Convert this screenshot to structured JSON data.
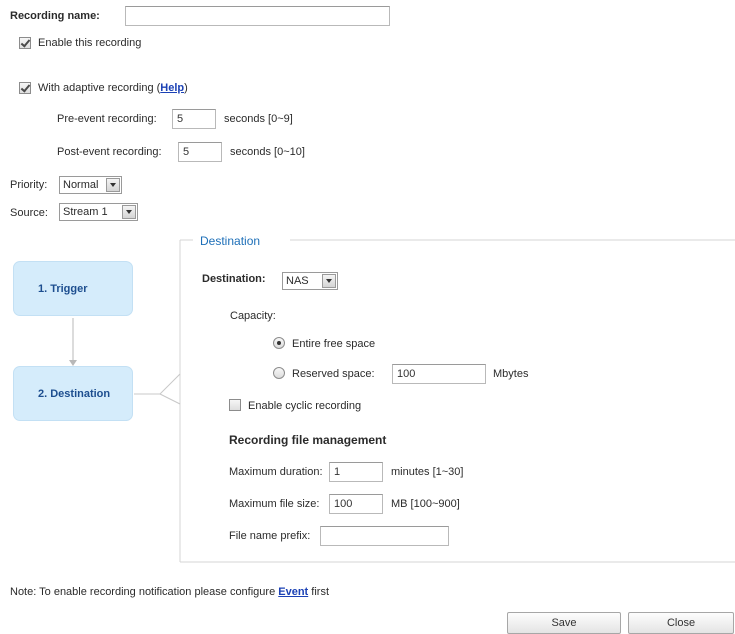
{
  "recording_name": {
    "label": "Recording name:",
    "value": ""
  },
  "enable_recording": {
    "label": "Enable this recording",
    "checked": true
  },
  "adaptive": {
    "label": "With adaptive recording (",
    "help_link": "Help",
    "label_close": ")",
    "checked": true,
    "pre_event": {
      "label": "Pre-event recording:",
      "value": "5",
      "unit": "seconds [0~9]"
    },
    "post_event": {
      "label": "Post-event recording:",
      "value": "5",
      "unit": "seconds [0~10]"
    }
  },
  "priority": {
    "label": "Priority:",
    "value": "Normal"
  },
  "source": {
    "label": "Source:",
    "value": "Stream 1"
  },
  "steps": {
    "trigger": "1. Trigger",
    "destination": "2. Destination"
  },
  "destination": {
    "section_title": "Destination",
    "label": "Destination:",
    "value": "NAS",
    "capacity": {
      "label": "Capacity:",
      "entire_free_space": "Entire free space",
      "reserved_space": "Reserved space:",
      "reserved_value": "100",
      "reserved_unit": "Mbytes",
      "selected": "entire_free_space"
    },
    "cyclic": {
      "label": "Enable cyclic recording",
      "checked": false
    },
    "file_mgmt": {
      "title": "Recording file management",
      "max_duration": {
        "label": "Maximum duration:",
        "value": "1",
        "unit": "minutes [1~30]"
      },
      "max_file_size": {
        "label": "Maximum file size:",
        "value": "100",
        "unit": "MB [100~900]"
      },
      "prefix": {
        "label": "File name prefix:",
        "value": ""
      }
    }
  },
  "note": {
    "text": "Note: To enable recording notification please configure ",
    "link": "Event",
    "suffix": " first"
  },
  "buttons": {
    "save": "Save",
    "close": "Close"
  },
  "colors": {
    "step_box": "#d5ecfb",
    "section_title": "#1d6fb8",
    "link": "#1b41b5"
  }
}
